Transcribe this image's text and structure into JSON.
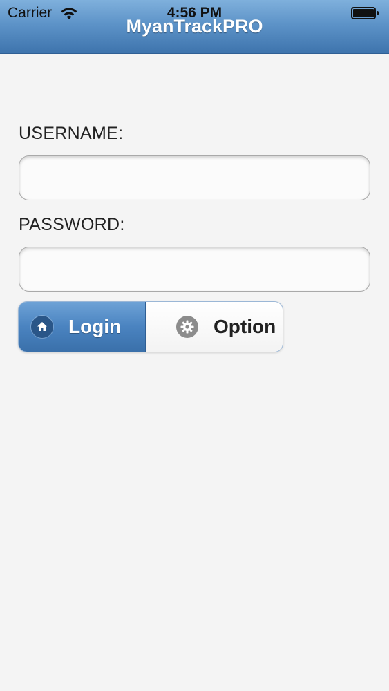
{
  "status_bar": {
    "carrier": "Carrier",
    "time": "4:56 PM",
    "wifi_icon": "wifi-icon",
    "battery_icon": "battery-icon",
    "battery_level": 1.0
  },
  "header": {
    "title": "MyanTrackPRO"
  },
  "form": {
    "username_label": "USERNAME:",
    "username_value": "",
    "password_label": "PASSWORD:",
    "password_value": ""
  },
  "buttons": {
    "login_label": "Login",
    "login_icon": "home-icon",
    "option_label": "Option",
    "option_icon": "gear-icon"
  },
  "colors": {
    "header_blue": "#5d93c8",
    "login_blue": "#4a83c0",
    "background": "#f4f4f4"
  }
}
